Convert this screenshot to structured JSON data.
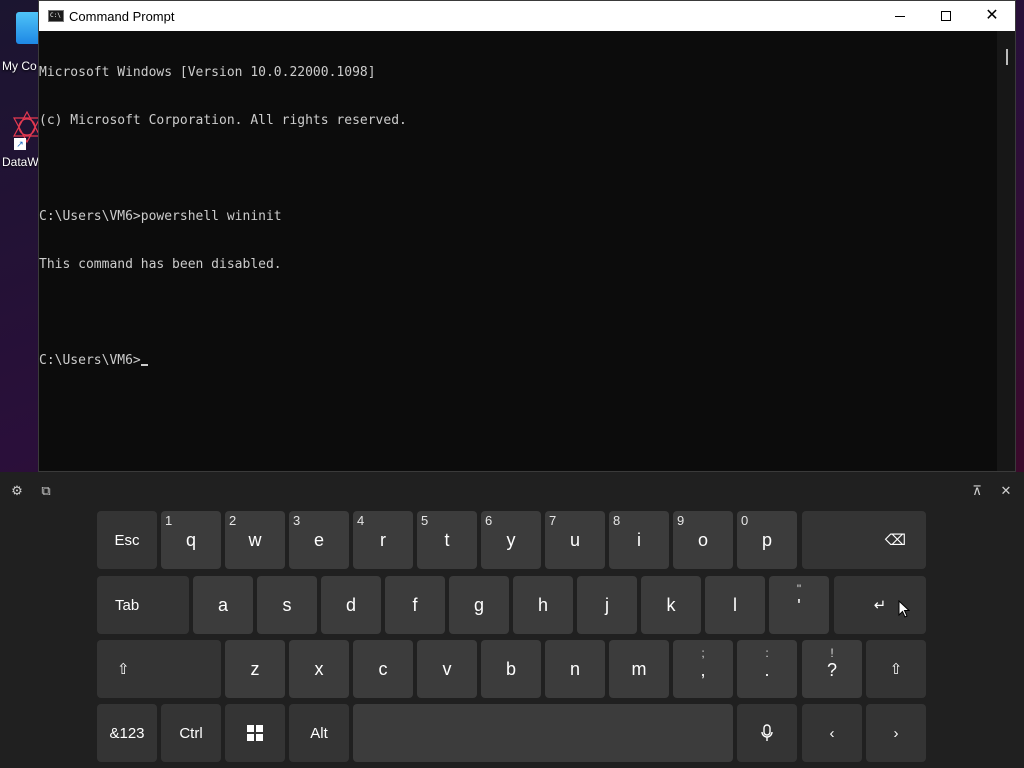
{
  "desktop": {
    "icons": [
      {
        "label": "My Co",
        "icon": "computer-icon"
      },
      {
        "label": "DataW",
        "icon": "datawrangler-icon"
      }
    ]
  },
  "window": {
    "title": "Command Prompt",
    "icon": "cmd-icon",
    "icon_text": "C:\\",
    "controls": {
      "minimize": "minimize-icon",
      "maximize": "maximize-icon",
      "close": "✕"
    }
  },
  "console": {
    "lines": [
      "Microsoft Windows [Version 10.0.22000.1098]",
      "(c) Microsoft Corporation. All rights reserved.",
      "",
      "C:\\Users\\VM6>powershell wininit",
      "This command has been disabled.",
      "",
      "C:\\Users\\VM6>"
    ]
  },
  "keyboard": {
    "toolbar": {
      "settings": "⚙",
      "sticker": "⧉",
      "dock": "⊼",
      "close": "✕"
    },
    "row1": [
      {
        "label": "Esc"
      },
      {
        "label": "q",
        "alt": "1"
      },
      {
        "label": "w",
        "alt": "2"
      },
      {
        "label": "e",
        "alt": "3"
      },
      {
        "label": "r",
        "alt": "4"
      },
      {
        "label": "t",
        "alt": "5"
      },
      {
        "label": "y",
        "alt": "6"
      },
      {
        "label": "u",
        "alt": "7"
      },
      {
        "label": "i",
        "alt": "8"
      },
      {
        "label": "o",
        "alt": "9"
      },
      {
        "label": "p",
        "alt": "0"
      },
      {
        "label": "⌫",
        "icon": "backspace-icon"
      }
    ],
    "row2": [
      {
        "label": "Tab"
      },
      {
        "label": "a"
      },
      {
        "label": "s"
      },
      {
        "label": "d"
      },
      {
        "label": "f"
      },
      {
        "label": "g"
      },
      {
        "label": "h"
      },
      {
        "label": "j"
      },
      {
        "label": "k"
      },
      {
        "label": "l"
      },
      {
        "label": "'",
        "top": "\""
      },
      {
        "label": "↵",
        "icon": "enter-icon"
      }
    ],
    "row3": [
      {
        "label": "⇧",
        "icon": "shift-icon"
      },
      {
        "label": "z"
      },
      {
        "label": "x"
      },
      {
        "label": "c"
      },
      {
        "label": "v"
      },
      {
        "label": "b"
      },
      {
        "label": "n"
      },
      {
        "label": "m"
      },
      {
        "label": ",",
        "top": ";"
      },
      {
        "label": ".",
        "top": ":"
      },
      {
        "label": "?",
        "top": "!"
      },
      {
        "label": "⇧",
        "icon": "shift-icon"
      }
    ],
    "row4": [
      {
        "label": "&123"
      },
      {
        "label": "Ctrl"
      },
      {
        "label": "",
        "icon": "windows-icon"
      },
      {
        "label": "Alt"
      },
      {
        "label": "",
        "icon": "space-icon"
      },
      {
        "label": "🎤",
        "icon": "microphone-icon"
      },
      {
        "label": "‹",
        "icon": "arrow-left-icon"
      },
      {
        "label": "›",
        "icon": "arrow-right-icon"
      }
    ]
  }
}
